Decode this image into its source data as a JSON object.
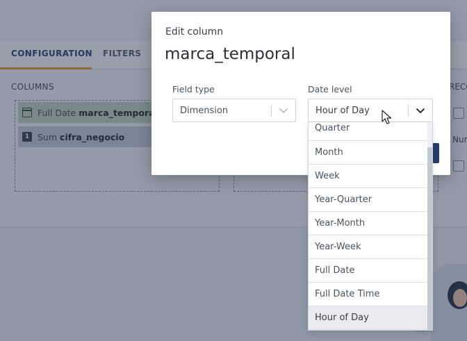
{
  "background": {
    "tabs": [
      "CONFIGURATION",
      "FILTERS"
    ],
    "columns_label": "COLUMNS",
    "chips": [
      {
        "aggregation": "Full Date",
        "field": "marca_temporal"
      },
      {
        "aggregation": "Sum",
        "field": "cifra_negocio"
      }
    ],
    "right_label": "RECO",
    "right_num_label": "Num",
    "measure_badge": "1"
  },
  "modal": {
    "subtitle": "Edit column",
    "title": "marca_temporal",
    "field_type": {
      "label": "Field type",
      "value": "Dimension"
    },
    "date_level": {
      "label": "Date level",
      "value": "Hour of Day"
    }
  },
  "menu": {
    "options": [
      "Quarter",
      "Month",
      "Week",
      "Year-Quarter",
      "Year-Month",
      "Year-Week",
      "Full Date",
      "Full Date Time",
      "Hour of Day"
    ],
    "selected": "Hour of Day"
  },
  "icons": {
    "calendar": "calendar-icon",
    "chevron": "chevron-down-icon",
    "cursor": "mouse-pointer-icon"
  }
}
